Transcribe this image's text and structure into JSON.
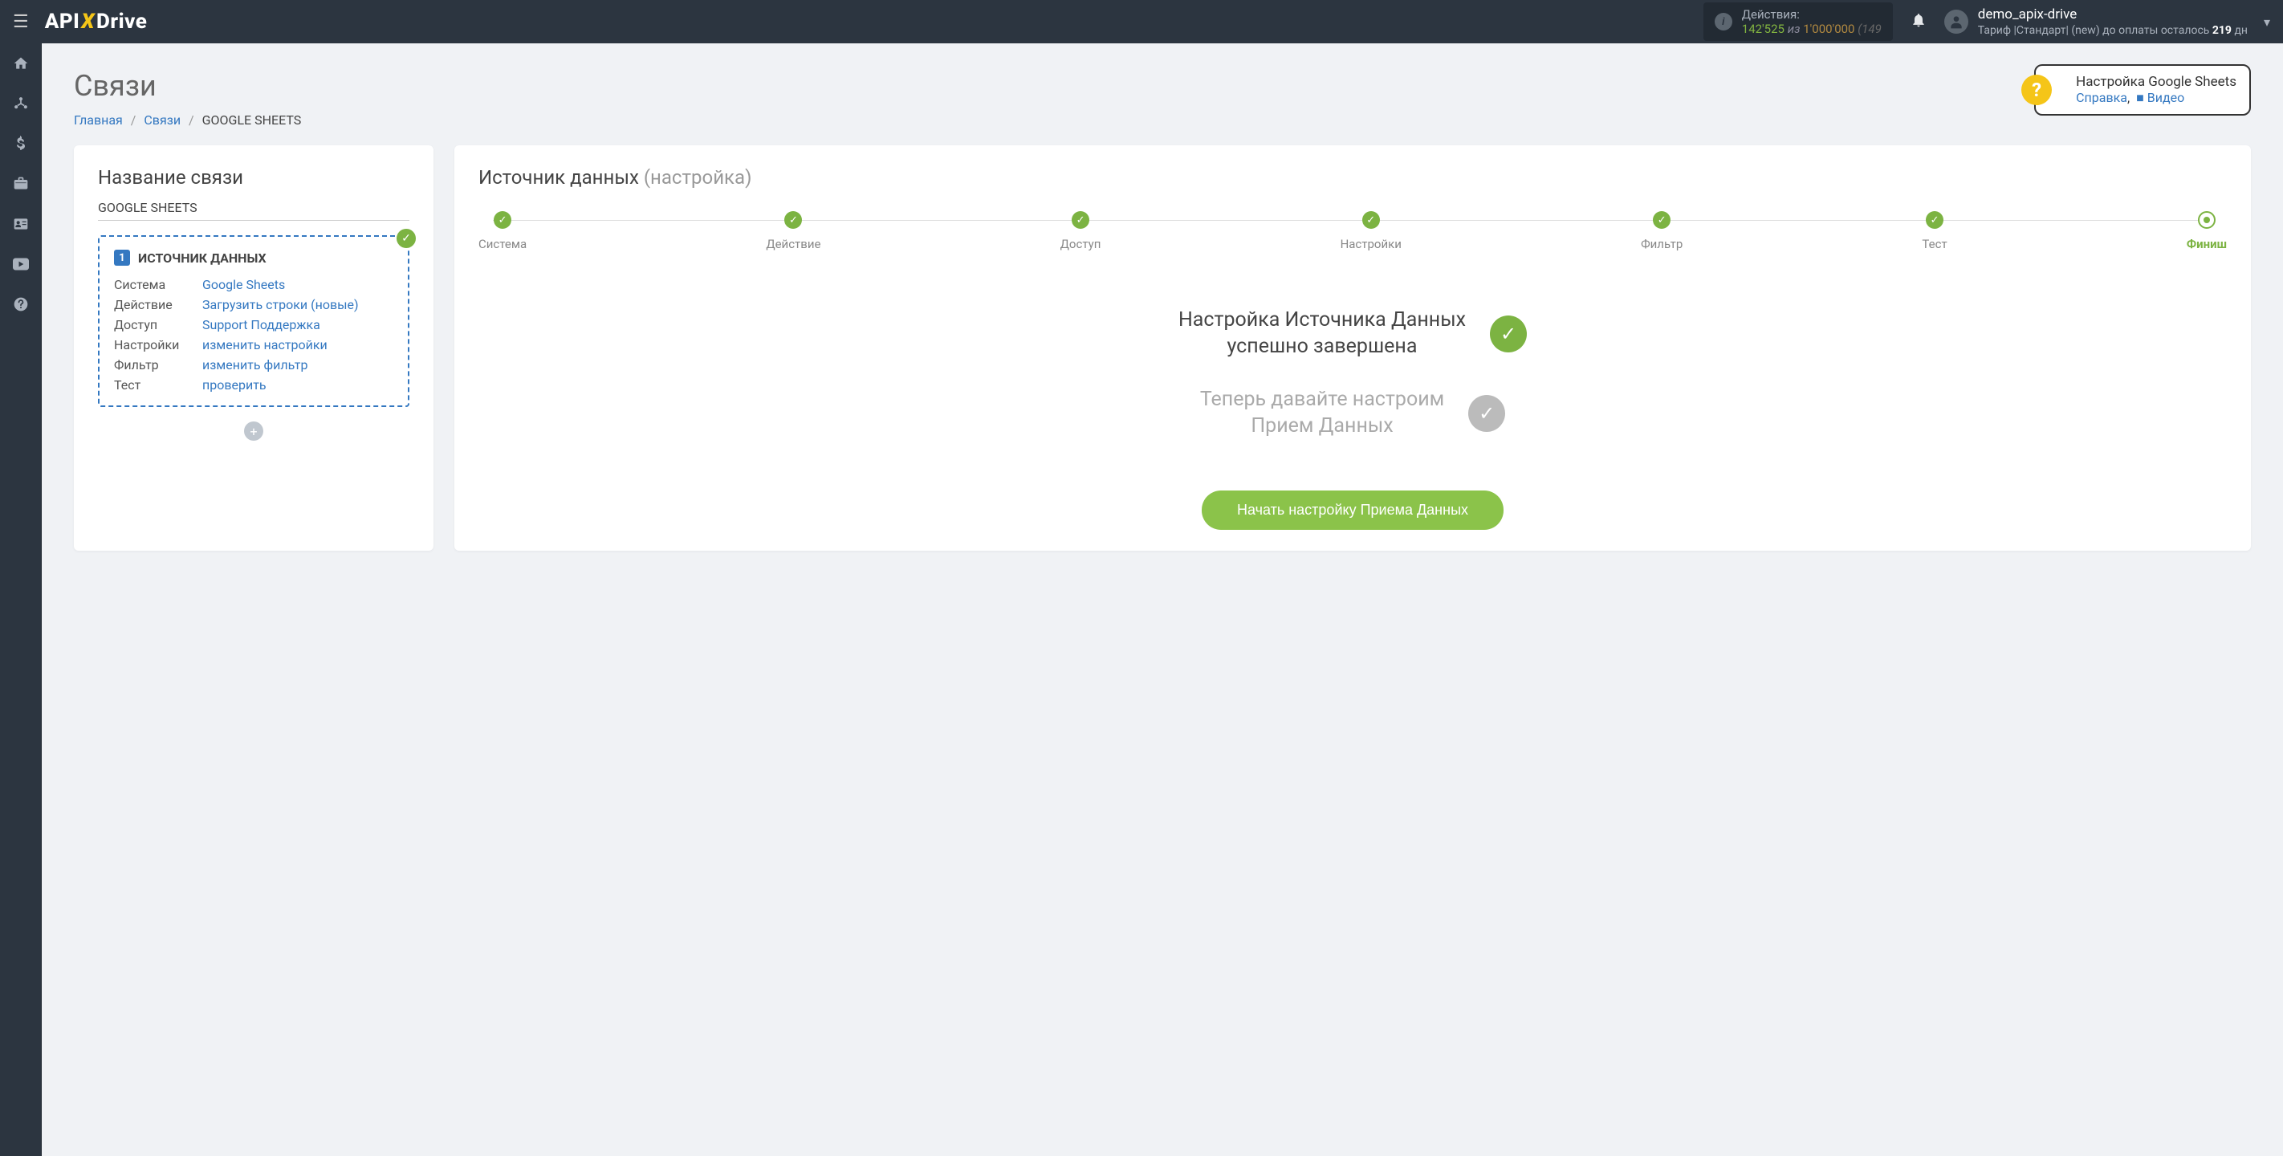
{
  "header": {
    "logo_api": "API",
    "logo_x": "X",
    "logo_drive": "Drive",
    "actions_label": "Действия:",
    "actions_used": "142'525",
    "actions_of": "из",
    "actions_total": "1'000'000",
    "actions_paren": "(149",
    "username": "demo_apix-drive",
    "tariff_text": "Тариф |Стандарт| (new) до оплаты осталось ",
    "tariff_days": "219",
    "tariff_unit": " дн"
  },
  "page": {
    "title": "Связи"
  },
  "breadcrumb": {
    "home": "Главная",
    "conns": "Связи",
    "current": "GOOGLE SHEETS"
  },
  "help": {
    "title": "Настройка Google Sheets",
    "ref": "Справка",
    "video": "Видео"
  },
  "left": {
    "title": "Название связи",
    "conn_name": "GOOGLE SHEETS",
    "source_label": "ИСТОЧНИК ДАННЫХ",
    "rows": [
      {
        "label": "Система",
        "value": "Google Sheets"
      },
      {
        "label": "Действие",
        "value": "Загрузить строки (новые)"
      },
      {
        "label": "Доступ",
        "value": "Support Поддержка"
      },
      {
        "label": "Настройки",
        "value": "изменить настройки"
      },
      {
        "label": "Фильтр",
        "value": "изменить фильтр"
      },
      {
        "label": "Тест",
        "value": "проверить"
      }
    ]
  },
  "right": {
    "title_main": "Источник данных ",
    "title_gray": "(настройка)",
    "steps": [
      "Система",
      "Действие",
      "Доступ",
      "Настройки",
      "Фильтр",
      "Тест",
      "Финиш"
    ],
    "success1_line1": "Настройка Источника Данных",
    "success1_line2": "успешно завершена",
    "success2_line1": "Теперь давайте настроим",
    "success2_line2": "Прием Данных",
    "start_btn": "Начать настройку Приема Данных"
  }
}
